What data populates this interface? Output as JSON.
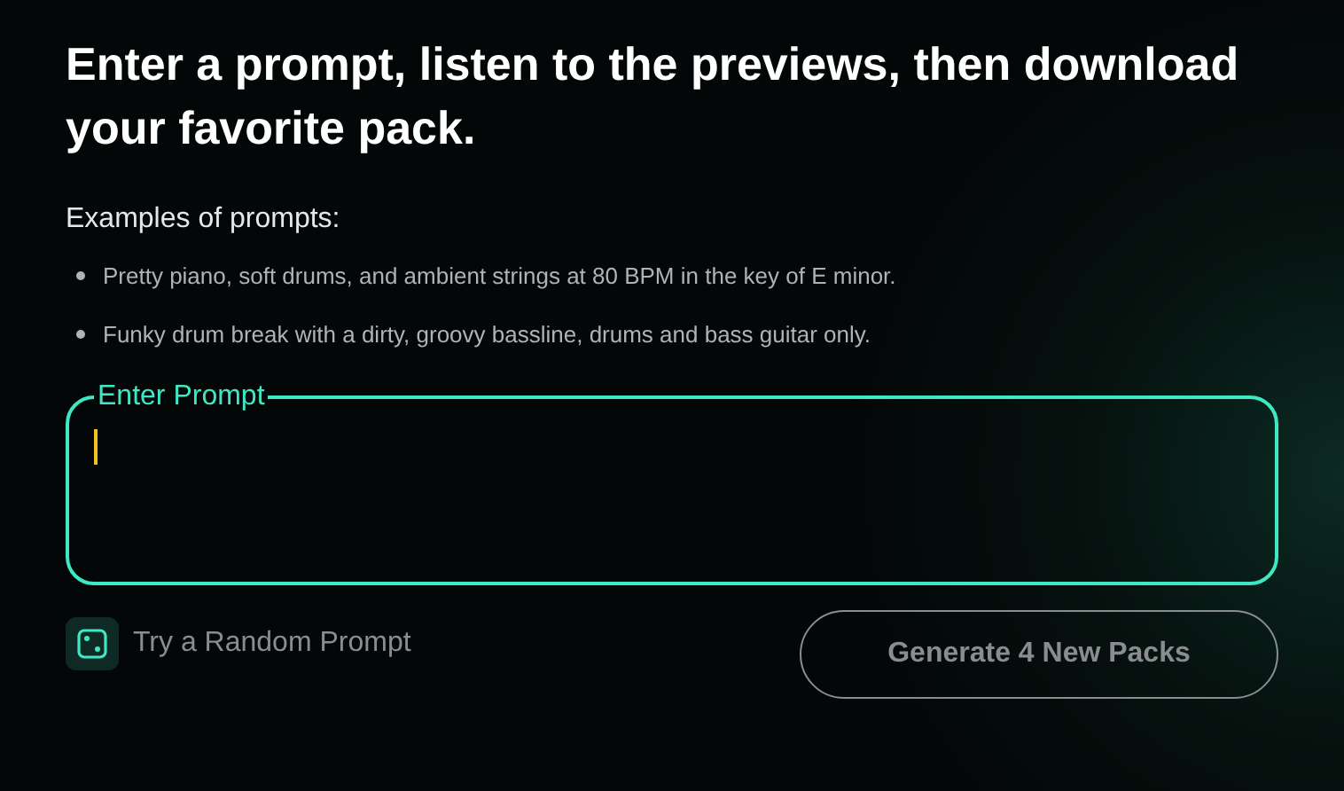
{
  "heading": "Enter a prompt, listen to the previews, then download your favorite pack.",
  "examples_title": "Examples of prompts:",
  "examples": [
    "Pretty piano, soft drums, and ambient strings at 80 BPM in the key of E minor.",
    "Funky drum break with a dirty, groovy bassline, drums and bass guitar only."
  ],
  "prompt_field": {
    "label": "Enter Prompt",
    "focused": true
  },
  "random_prompt": {
    "label": "Try a Random Prompt"
  },
  "generate_button": {
    "label": "Generate 4 New Packs",
    "disabled": true
  }
}
